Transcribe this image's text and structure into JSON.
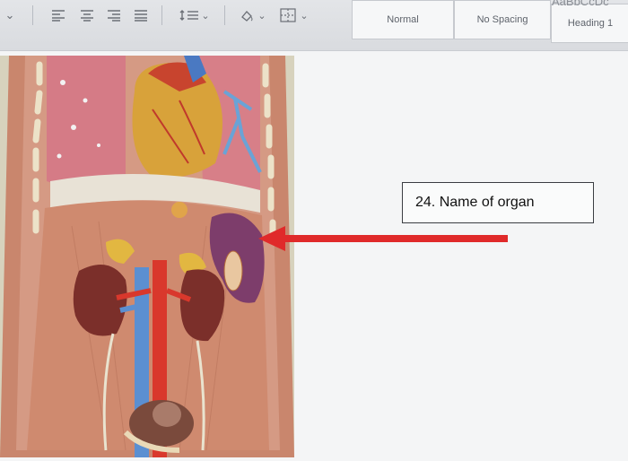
{
  "toolbar": {
    "dropdown_glyph": "⌄",
    "align_icons": [
      "align-left-icon",
      "align-center-icon",
      "align-right-icon",
      "justify-icon"
    ],
    "list_icon": "line-spacing-icon",
    "shading_icon": "shading-icon",
    "borders_icon": "borders-icon"
  },
  "styles": [
    {
      "label": "Normal"
    },
    {
      "label": "No Spacing"
    },
    {
      "label": "Heading 1"
    }
  ],
  "styles_preview_partial": "AaBbCcDc",
  "question": {
    "label": "24. Name of organ"
  },
  "colors": {
    "arrow": "#e02a2a",
    "spleen": "#7d3d6b"
  }
}
